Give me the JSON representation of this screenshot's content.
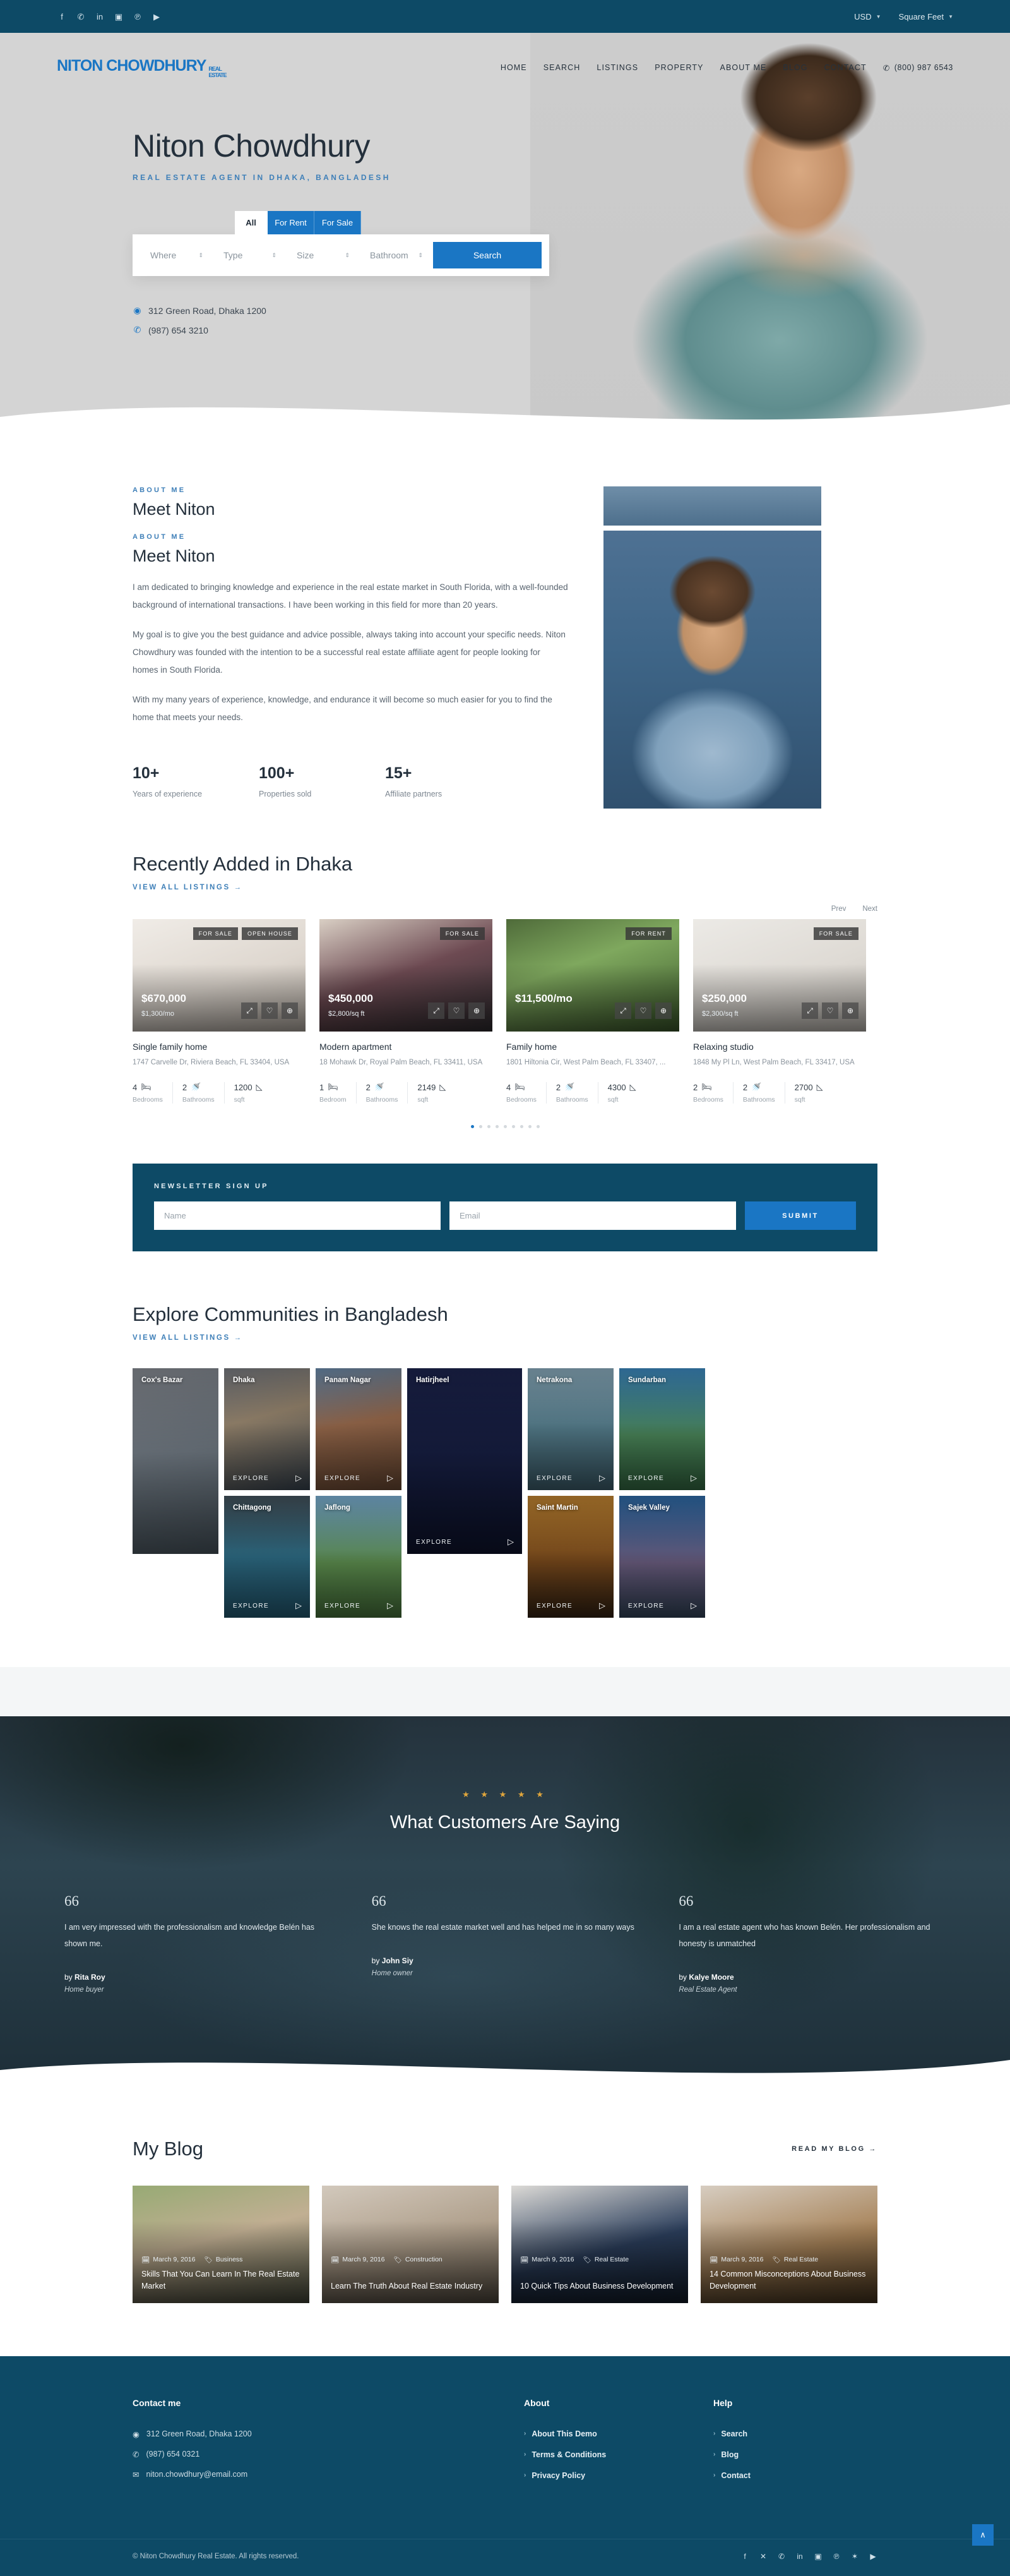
{
  "topbar": {
    "socials": [
      "f",
      "✆",
      "in",
      "▣",
      "℗",
      "▶"
    ],
    "currency": "USD",
    "units": "Square Feet"
  },
  "nav": {
    "logo_main": "NITON CHOWDHURY",
    "logo_sub": "REAL ESTATE",
    "links": [
      "HOME",
      "SEARCH",
      "LISTINGS",
      "PROPERTY",
      "ABOUT ME",
      "BLOG",
      "CONTACT"
    ],
    "phone": "(800) 987 6543"
  },
  "hero": {
    "title": "Niton Chowdhury",
    "subtitle": "REAL ESTATE AGENT IN DHAKA, BANGLADESH",
    "tabs": [
      "All",
      "For Rent",
      "For Sale"
    ],
    "active_tab": "All",
    "fields": [
      "Where",
      "Type",
      "Size",
      "Bathroom"
    ],
    "search_label": "Search",
    "address": "312 Green Road, Dhaka 1200",
    "phone": "(987) 654 3210"
  },
  "about": {
    "eyebrow": "ABOUT ME",
    "heading": "Meet Niton",
    "eyebrow2": "ABOUT ME",
    "heading2": "Meet Niton",
    "p1": "I am dedicated to bringing knowledge and experience in the real estate market in South Florida, with a well-founded background of international transactions. I have been working in this field for more than 20 years.",
    "p2": "My goal is to give you the best guidance and advice possible, always taking into account your specific needs. Niton Chowdhury was founded with the intention to be a successful real estate affiliate agent for people looking for homes in South Florida.",
    "p3": "With my many years of experience, knowledge, and endurance it will become so much easier for you to find the home that meets your needs.",
    "stats": [
      {
        "number": "10+",
        "label": "Years of experience"
      },
      {
        "number": "100+",
        "label": "Properties sold"
      },
      {
        "number": "15+",
        "label": "Affiliate partners"
      }
    ]
  },
  "listings": {
    "heading": "Recently Added in Dhaka",
    "view_all": "VIEW ALL LISTINGS →",
    "prev": "Prev",
    "next": "Next",
    "cards": [
      {
        "badges": [
          "FOR SALE",
          "OPEN HOUSE"
        ],
        "price": "$670,000",
        "subprice": "$1,300/mo",
        "title": "Single family home",
        "address": "1747 Carvelle Dr, Riviera Beach, FL 33404, USA",
        "beds": "4",
        "beds_label": "Bedrooms",
        "baths": "2",
        "baths_label": "Bathrooms",
        "sqft": "1200",
        "sqft_label": "sqft"
      },
      {
        "badges": [
          "FOR SALE"
        ],
        "price": "$450,000",
        "subprice": "$2,800/sq ft",
        "title": "Modern apartment",
        "address": "18 Mohawk Dr, Royal Palm Beach, FL 33411, USA",
        "beds": "1",
        "beds_label": "Bedroom",
        "baths": "2",
        "baths_label": "Bathrooms",
        "sqft": "2149",
        "sqft_label": "sqft"
      },
      {
        "badges": [
          "FOR RENT"
        ],
        "price": "$11,500/mo",
        "subprice": "",
        "title": "Family home",
        "address": "1801 Hiltonia Cir, West Palm Beach, FL 33407, ...",
        "beds": "4",
        "beds_label": "Bedrooms",
        "baths": "2",
        "baths_label": "Bathrooms",
        "sqft": "4300",
        "sqft_label": "sqft"
      },
      {
        "badges": [
          "FOR SALE"
        ],
        "price": "$250,000",
        "subprice": "$2,300/sq ft",
        "title": "Relaxing studio",
        "address": "1848 My Pl Ln, West Palm Beach, FL 33417, USA",
        "beds": "2",
        "beds_label": "Bedrooms",
        "baths": "2",
        "baths_label": "Bathrooms",
        "sqft": "2700",
        "sqft_label": "sqft"
      }
    ]
  },
  "newsletter": {
    "title": "NEWSLETTER SIGN UP",
    "name_placeholder": "Name",
    "email_placeholder": "Email",
    "submit": "SUBMIT"
  },
  "communities": {
    "heading": "Explore Communities in Bangladesh",
    "view_all": "VIEW ALL LISTINGS →",
    "explore_label": "EXPLORE",
    "tiles": [
      {
        "name": "Cox's Bazar"
      },
      {
        "name": "Dhaka"
      },
      {
        "name": "Panam Nagar"
      },
      {
        "name": "Hatirjheel"
      },
      {
        "name": "Netrakona"
      },
      {
        "name": "Sundarban"
      },
      {
        "name": "Chittagong"
      },
      {
        "name": "Jaflong"
      },
      {
        "name": "Saint Martin"
      },
      {
        "name": "Sajek Valley"
      }
    ]
  },
  "testimonials": {
    "heading": "What Customers Are Saying",
    "stars": "★ ★ ★ ★ ★",
    "items": [
      {
        "mark": "66",
        "text": "I am very impressed with the professionalism and knowledge Belén has shown me.",
        "by_prefix": "by ",
        "author": "Rita Roy",
        "role": "Home buyer"
      },
      {
        "mark": "66",
        "text": "She knows the real estate market well and has helped me in so many ways",
        "by_prefix": "by ",
        "author": "John Siy",
        "role": "Home owner"
      },
      {
        "mark": "66",
        "text": "I am a real estate agent who has known Belén. Her professionalism and honesty is unmatched",
        "by_prefix": "by ",
        "author": "Kalye Moore",
        "role": "Real Estate Agent"
      }
    ]
  },
  "blog": {
    "heading": "My Blog",
    "read_more": "READ MY BLOG →",
    "posts": [
      {
        "date": "March 9, 2016",
        "category": "Business",
        "title": "Skills That You Can Learn In The Real Estate Market"
      },
      {
        "date": "March 9, 2016",
        "category": "Construction",
        "title": "Learn The Truth About Real Estate Industry"
      },
      {
        "date": "March 9, 2016",
        "category": "Real Estate",
        "title": "10 Quick Tips About Business Development"
      },
      {
        "date": "March 9, 2016",
        "category": "Real Estate",
        "title": "14 Common Misconceptions About Business Development"
      }
    ]
  },
  "footer": {
    "contact_title": "Contact me",
    "address": "312 Green Road, Dhaka 1200",
    "phone": "(987) 654 0321",
    "email": "niton.chowdhury@email.com",
    "about_title": "About",
    "about_links": [
      "About This Demo",
      "Terms & Conditions",
      "Privacy Policy"
    ],
    "help_title": "Help",
    "help_links": [
      "Search",
      "Blog",
      "Contact"
    ],
    "copyright": "© Niton Chowdhury Real Estate. All rights reserved.",
    "socials": [
      "f",
      "✕",
      "✆",
      "in",
      "▣",
      "℗",
      "✶",
      "▶"
    ],
    "to_top": "∧"
  },
  "colors": {
    "brand": "#1a76c4",
    "dark": "#0d4a66",
    "accent": "#3e7fb8"
  }
}
